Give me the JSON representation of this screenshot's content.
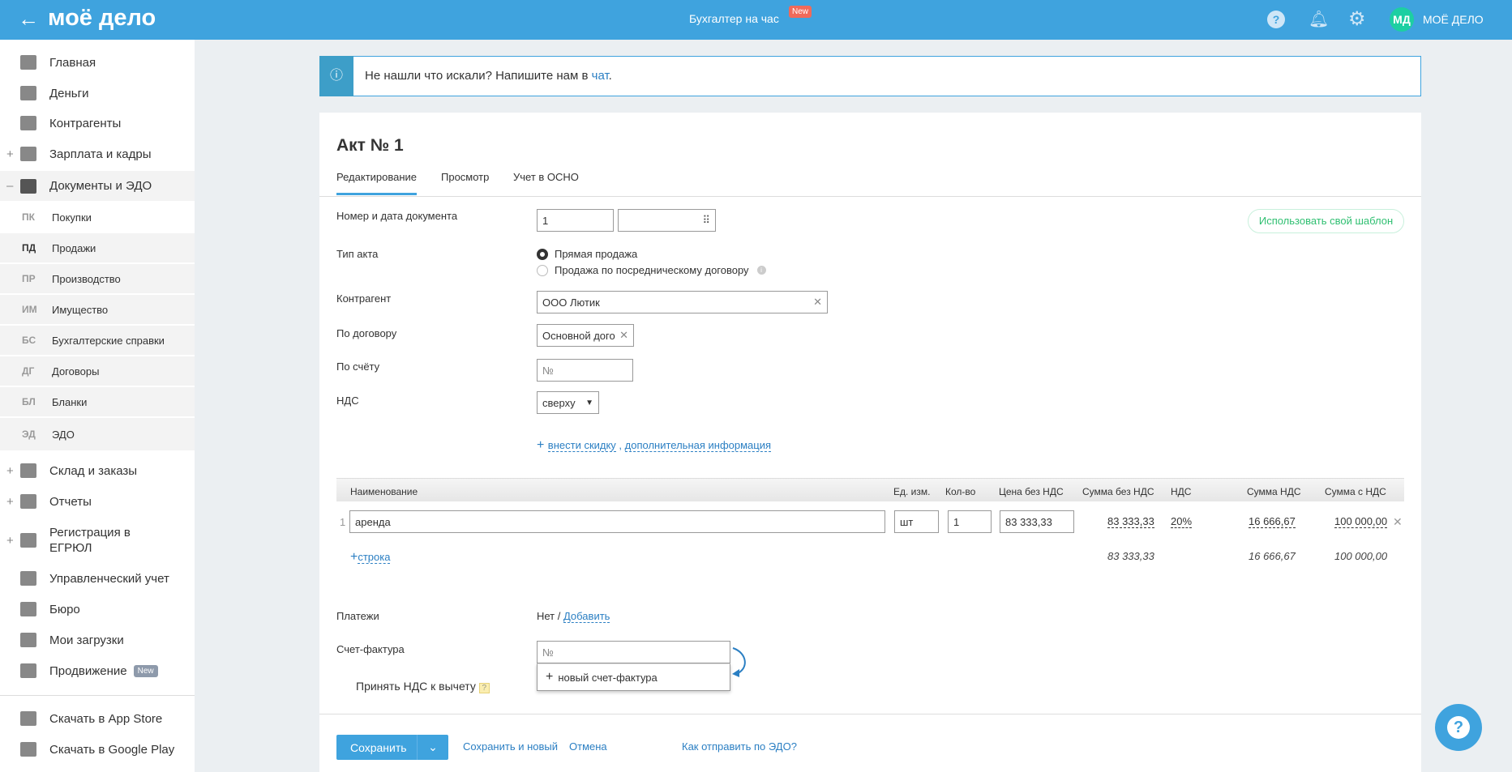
{
  "header": {
    "logo": "моё дело",
    "center_title": "Бухгалтер на час",
    "new_badge": "New",
    "avatar": "МД",
    "user": "МОЁ ДЕЛО"
  },
  "sidebar": {
    "items": [
      {
        "label": "Главная"
      },
      {
        "label": "Деньги"
      },
      {
        "label": "Контрагенты"
      },
      {
        "label": "Зарплата и кадры",
        "prefix": "+"
      },
      {
        "label": "Документы и ЭДО",
        "prefix": "–"
      }
    ],
    "sub": [
      {
        "abbr": "ПК",
        "label": "Покупки"
      },
      {
        "abbr": "ПД",
        "label": "Продажи"
      },
      {
        "abbr": "ПР",
        "label": "Производство"
      },
      {
        "abbr": "ИМ",
        "label": "Имущество"
      },
      {
        "abbr": "БС",
        "label": "Бухгалтерские справки"
      },
      {
        "abbr": "ДГ",
        "label": "Договоры"
      },
      {
        "abbr": "БЛ",
        "label": "Бланки"
      },
      {
        "abbr": "ЭД",
        "label": "ЭДО"
      }
    ],
    "items2": [
      {
        "label": "Склад и заказы",
        "prefix": "+"
      },
      {
        "label": "Отчеты",
        "prefix": "+"
      },
      {
        "label": "Регистрация в ЕГРЮЛ",
        "prefix": "+"
      },
      {
        "label": "Управленческий учет"
      },
      {
        "label": "Бюро"
      },
      {
        "label": "Мои загрузки"
      },
      {
        "label": "Продвижение",
        "badge": "New"
      }
    ],
    "stores": [
      {
        "label": "Скачать в App Store"
      },
      {
        "label": "Скачать в Google Play"
      }
    ]
  },
  "banner": {
    "text": "Не нашли что искали? Напишите нам в ",
    "link": "чат",
    "tail": "."
  },
  "doc": {
    "title": "Акт № 1",
    "tabs": [
      "Редактирование",
      "Просмотр",
      "Учет в ОСНО"
    ],
    "template_button": "Использовать свой шаблон",
    "fields": {
      "number_label": "Номер и дата документа",
      "number": "1",
      "type_label": "Тип акта",
      "type_options": [
        "Прямая продажа",
        "Продажа по посредническому договору"
      ],
      "counterparty_label": "Контрагент",
      "counterparty": "ООО Лютик",
      "contract_label": "По договору",
      "contract": "Основной дого",
      "account_label": "По счёту",
      "account_placeholder": "№",
      "vat_label": "НДС",
      "vat": "сверху",
      "discount_link": "внести скидку",
      "extra_link": "дополнительная информация"
    }
  },
  "table": {
    "headers": [
      "Наименование",
      "Ед. изм.",
      "Кол-во",
      "Цена без НДС",
      "Сумма без НДС",
      "НДС",
      "Сумма НДС",
      "Сумма с НДС"
    ],
    "rows": [
      {
        "n": "1",
        "name": "аренда",
        "unit": "шт",
        "qty": "1",
        "price": "83 333,33",
        "sum": "83 333,33",
        "vat": "20%",
        "vat_sum": "16 666,67",
        "total": "100 000,00"
      }
    ],
    "add_row": "строка",
    "totals": {
      "sum": "83 333,33",
      "vat_sum": "16 666,67",
      "total": "100 000,00"
    }
  },
  "payments": {
    "label": "Платежи",
    "value": "Нет / ",
    "add": "Добавить"
  },
  "invoice": {
    "label": "Счет-фактура",
    "placeholder": "№",
    "new": "новый счет-фактура",
    "vat_accept": "Принять НДС к вычету",
    "help": "?"
  },
  "footer": {
    "save": "Сохранить",
    "save_new": "Сохранить и новый",
    "cancel": "Отмена",
    "edo": "Как отправить по ЭДО?"
  },
  "colors": {
    "brand": "#3fa3de",
    "link": "#2b7fc3",
    "green": "#2fbf71"
  }
}
